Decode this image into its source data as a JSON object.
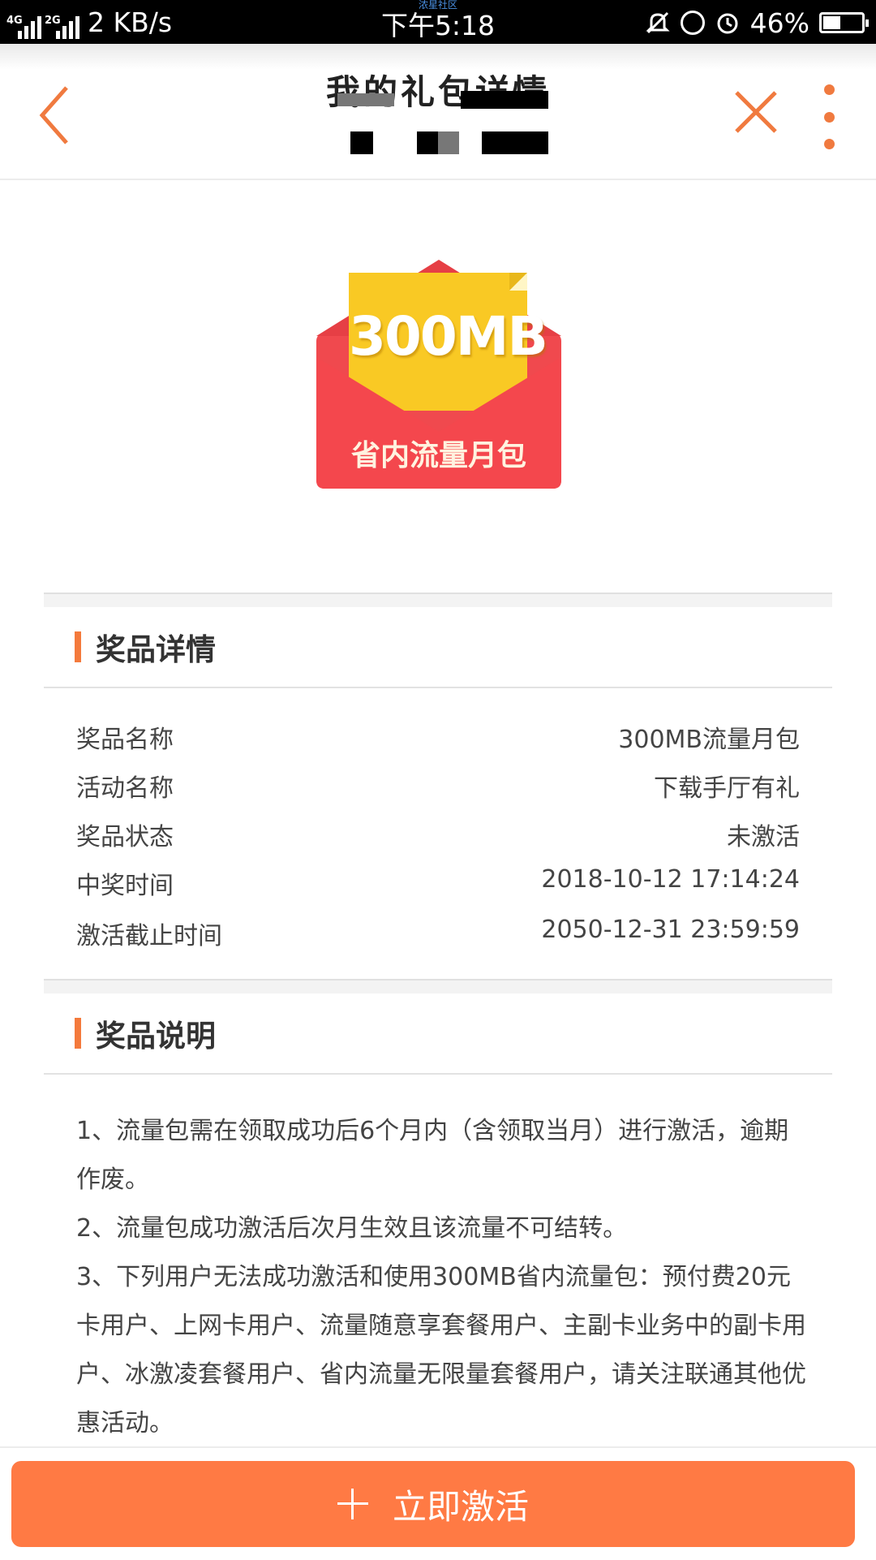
{
  "status_bar": {
    "signal1_tag": "4G",
    "signal2_tag": "2G",
    "net_speed": "2 KB/s",
    "app_name": "浓星社区",
    "time": "下午5:18",
    "battery": "46%",
    "battery_level": 0.46
  },
  "header": {
    "title": "我的礼包详情",
    "back_icon": "chevron-left-icon",
    "close_icon": "close-icon",
    "more_icon": "more-vertical-icon",
    "accent": "#f07a3f"
  },
  "prize_image": {
    "amount": "300MB",
    "label": "省内流量月包"
  },
  "details": {
    "heading": "奖品详情",
    "rows": [
      {
        "key": "奖品名称",
        "value": "300MB流量月包"
      },
      {
        "key": "活动名称",
        "value": "下载手厅有礼"
      },
      {
        "key": "奖品状态",
        "value": "未激活"
      },
      {
        "key": "中奖时间",
        "value": "2018-10-12 17:14:24"
      },
      {
        "key": "激活截止时间",
        "value": "2050-12-31 23:59:59"
      }
    ]
  },
  "description": {
    "heading": "奖品说明",
    "items": [
      "1、流量包需在领取成功后6个月内（含领取当月）进行激活，逾期作废。",
      "2、流量包成功激活后次月生效且该流量不可结转。",
      "3、下列用户无法成功激活和使用300MB省内流量包：预付费20元卡用户、上网卡用户、流量随意享套餐用户、主副卡业务中的副卡用户、冰激凌套餐用户、省内流量无限量套餐用户，请关注联通其他优惠活动。"
    ]
  },
  "footer": {
    "activate_label": "立即激活",
    "activate_icon": "plus-icon",
    "button_color": "#ff7a44"
  }
}
